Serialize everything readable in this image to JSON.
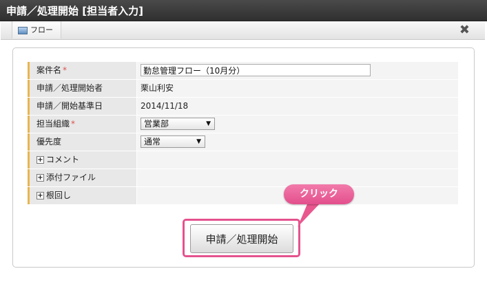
{
  "window": {
    "title": "申請／処理開始 [担当者入力]"
  },
  "toolbar": {
    "flow_tab_label": "フロー",
    "close_icon": "close-icon"
  },
  "form": {
    "rows": [
      {
        "label": "案件名",
        "required": true,
        "input_value": "勤怠管理フロー（10月分）"
      },
      {
        "label": "申請／処理開始者",
        "value": "栗山利安"
      },
      {
        "label": "申請／開始基準日",
        "value": "2014/11/18"
      },
      {
        "label": "担当組織",
        "required": true,
        "select_value": "営業部"
      },
      {
        "label": "優先度",
        "select_value": "通常"
      },
      {
        "label": "コメント",
        "expandable": true
      },
      {
        "label": "添付ファイル",
        "expandable": true
      },
      {
        "label": "根回し",
        "expandable": true
      }
    ],
    "required_mark": "*",
    "expand_glyph": "+",
    "select_arrow": "▼"
  },
  "actions": {
    "submit_label": "申請／処理開始"
  },
  "callout": {
    "text": "クリック",
    "color": "#e8588f"
  },
  "colors": {
    "titlebar": "#3a3a3a",
    "label_accent": "#e8b64c",
    "highlight": "#e4528d"
  }
}
